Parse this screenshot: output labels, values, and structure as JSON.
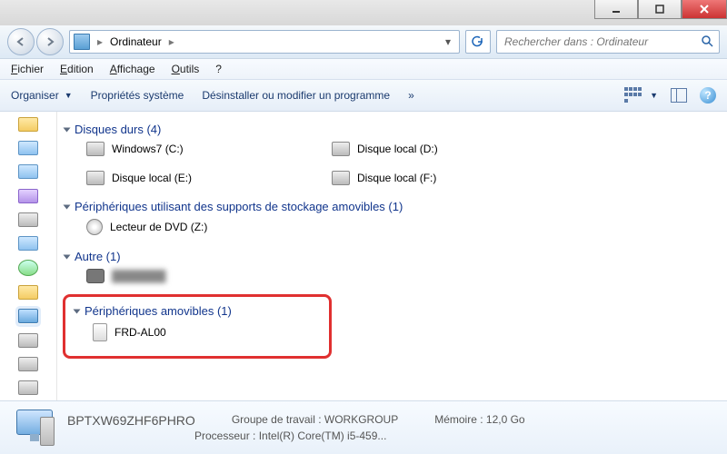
{
  "breadcrumb": {
    "root_label": "Ordinateur"
  },
  "search": {
    "placeholder": "Rechercher dans : Ordinateur"
  },
  "menubar": {
    "file": "Fichier",
    "edit": "Edition",
    "view": "Affichage",
    "tools": "Outils",
    "help": "?"
  },
  "toolbar": {
    "organize": "Organiser",
    "properties": "Propriétés système",
    "uninstall": "Désinstaller ou modifier un programme",
    "overflow": "»"
  },
  "groups": {
    "hdd": {
      "title": "Disques durs (4)",
      "items": [
        {
          "label": "Windows7 (C:)"
        },
        {
          "label": "Disque local (D:)"
        },
        {
          "label": "Disque local (E:)"
        },
        {
          "label": "Disque local (F:)"
        }
      ]
    },
    "removable_storage": {
      "title": "Périphériques utilisant des supports de stockage amovibles (1)",
      "items": [
        {
          "label": "Lecteur de DVD (Z:)"
        }
      ]
    },
    "other": {
      "title": "Autre (1)",
      "items": [
        {
          "label": "███████"
        }
      ]
    },
    "removable_devices": {
      "title": "Périphériques amovibles (1)",
      "items": [
        {
          "label": "FRD-AL00"
        }
      ]
    }
  },
  "details": {
    "computer_name": "BPTXW69ZHF6PHRO",
    "workgroup_label": "Groupe de travail :",
    "workgroup_value": "WORKGROUP",
    "memory_label": "Mémoire :",
    "memory_value": "12,0 Go",
    "processor_label": "Processeur :",
    "processor_value": "Intel(R) Core(TM) i5-459..."
  }
}
